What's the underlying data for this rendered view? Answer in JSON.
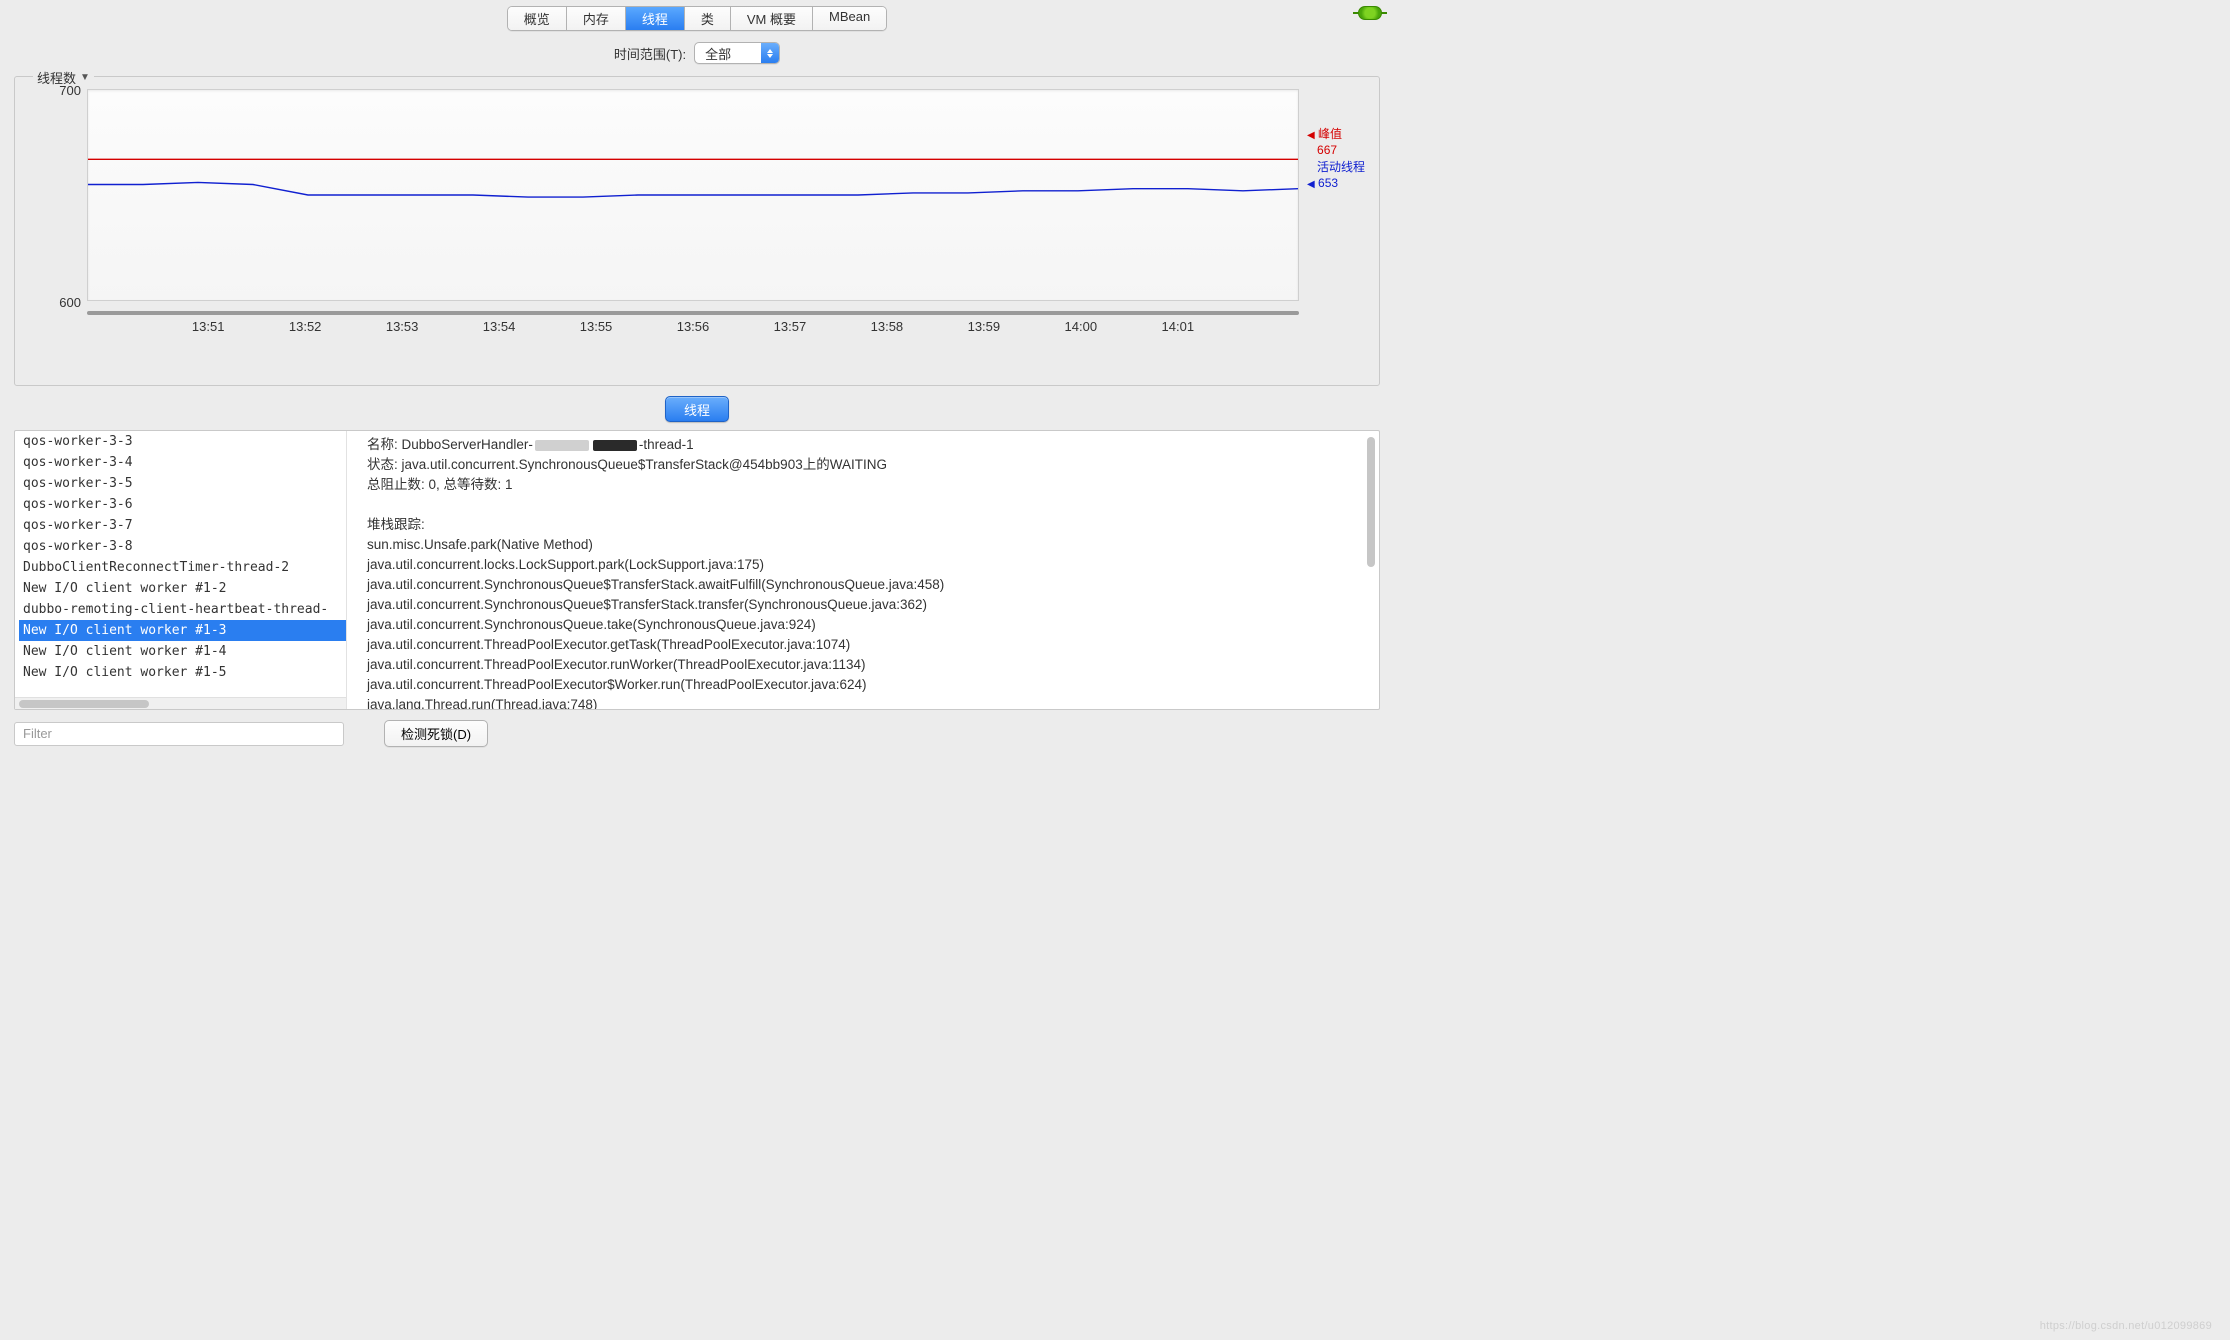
{
  "tabs": {
    "overview": "概览",
    "memory": "内存",
    "threads": "线程",
    "classes": "类",
    "vm_summary": "VM 概要",
    "mbean": "MBean",
    "selected": "threads"
  },
  "time_range": {
    "label": "时间范围(T):",
    "value": "全部"
  },
  "chart_title": "线程数",
  "chart_data": {
    "type": "line",
    "title": "线程数",
    "ylabel": "线程数",
    "ylim": [
      600,
      700
    ],
    "y_ticks": [
      600,
      700
    ],
    "x_ticks": [
      "13:51",
      "13:52",
      "13:53",
      "13:54",
      "13:55",
      "13:56",
      "13:57",
      "13:58",
      "13:59",
      "14:00",
      "14:01"
    ],
    "series": [
      {
        "name": "峰值",
        "color": "#d40000",
        "current": 667,
        "values": [
          667,
          667,
          667,
          667,
          667,
          667,
          667,
          667,
          667,
          667,
          667,
          667,
          667,
          667,
          667,
          667,
          667,
          667,
          667,
          667,
          667,
          667,
          667
        ]
      },
      {
        "name": "活动线程",
        "color": "#1020d0",
        "current": 653,
        "values": [
          655,
          655,
          656,
          655,
          650,
          650,
          650,
          650,
          649,
          649,
          650,
          650,
          650,
          650,
          650,
          651,
          651,
          652,
          652,
          653,
          653,
          652,
          653
        ]
      }
    ],
    "legend": {
      "peak_label": "峰值",
      "peak_value": "667",
      "active_label": "活动线程",
      "active_value": "653"
    }
  },
  "threads_button": "线程",
  "thread_list": [
    "qos-worker-3-3",
    "qos-worker-3-4",
    "qos-worker-3-5",
    "qos-worker-3-6",
    "qos-worker-3-7",
    "qos-worker-3-8",
    "DubboClientReconnectTimer-thread-2",
    "New I/O client worker #1-2",
    "dubbo-remoting-client-heartbeat-thread-",
    "New I/O client worker #1-3",
    "New I/O client worker #1-4",
    "New I/O client worker #1-5"
  ],
  "selected_thread_index": 9,
  "detail": {
    "name_label": "名称: ",
    "name_prefix": "DubboServerHandler-",
    "name_suffix": "-thread-1",
    "state_label": "状态: ",
    "state_value": "java.util.concurrent.SynchronousQueue$TransferStack@454bb903上的WAITING",
    "counts": "总阻止数: 0, 总等待数: 1",
    "stack_header": "堆栈跟踪:",
    "stack": [
      "sun.misc.Unsafe.park(Native Method)",
      "java.util.concurrent.locks.LockSupport.park(LockSupport.java:175)",
      "java.util.concurrent.SynchronousQueue$TransferStack.awaitFulfill(SynchronousQueue.java:458)",
      "java.util.concurrent.SynchronousQueue$TransferStack.transfer(SynchronousQueue.java:362)",
      "java.util.concurrent.SynchronousQueue.take(SynchronousQueue.java:924)",
      "java.util.concurrent.ThreadPoolExecutor.getTask(ThreadPoolExecutor.java:1074)",
      "java.util.concurrent.ThreadPoolExecutor.runWorker(ThreadPoolExecutor.java:1134)",
      "java.util.concurrent.ThreadPoolExecutor$Worker.run(ThreadPoolExecutor.java:624)",
      "java.lang.Thread.run(Thread.java:748)"
    ]
  },
  "filter_placeholder": "Filter",
  "deadlock_button": "检测死锁(D)",
  "watermark": "https://blog.csdn.net/u012099869"
}
